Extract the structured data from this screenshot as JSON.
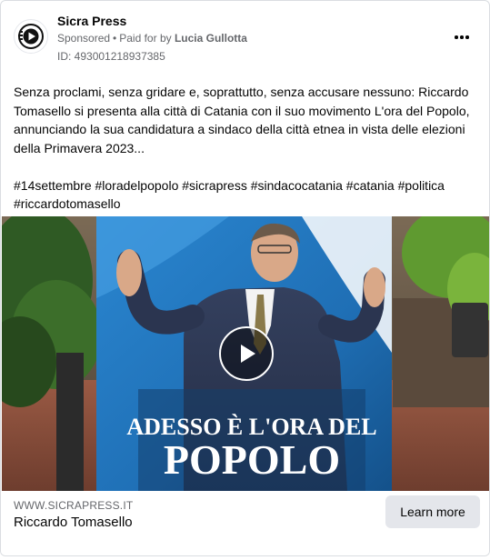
{
  "post": {
    "page_name": "Sicra Press",
    "sponsored_label": "Sponsored",
    "separator": "•",
    "paid_for_label": "Paid for by",
    "payer": "Lucia Gullotta",
    "ad_id": "ID: 493001218937385",
    "more_icon": "more-horizontal-icon",
    "avatar_icon": "sicrapress-logo-icon"
  },
  "body": {
    "text": "Senza proclami, senza gridare e, soprattutto, senza accusare nessuno: Riccardo Tomasello si presenta alla città di Catania con il suo movimento L'ora del Popolo, annunciando la sua candidatura a sindaco della città etnea in vista delle elezioni della Primavera 2023...",
    "hashtags": "#14settembre #loradelpopolo #sicrapress #sindacocatania #catania #politica #riccardotomasello"
  },
  "media": {
    "banner_line1": "ADESSO È L'ORA DEL",
    "banner_line2": "POPOLO",
    "play_icon": "play-icon"
  },
  "footer": {
    "site_url": "WWW.SICRAPRESS.IT",
    "link_title": "Riccardo Tomasello",
    "cta_label": "Learn more"
  },
  "colors": {
    "text_primary": "#050505",
    "text_secondary": "#65676b",
    "button_bg": "#e4e6eb",
    "border": "#dadde1",
    "banner_blue": "#1f6fb5"
  }
}
